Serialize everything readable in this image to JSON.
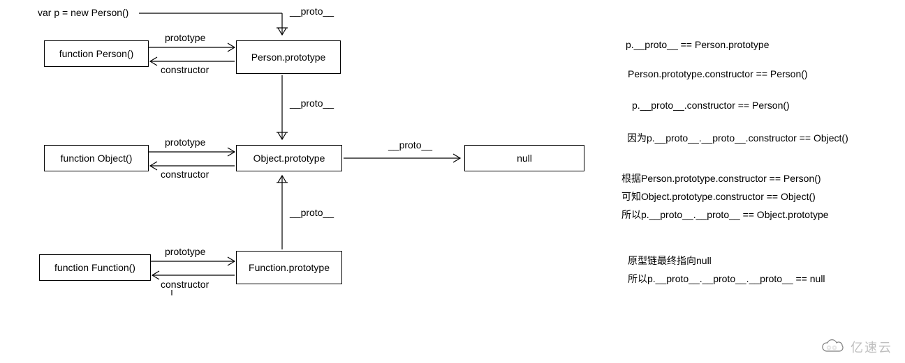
{
  "topText": "var p = new Person()",
  "boxes": {
    "personFn": "function Person()",
    "personProto": "Person.prototype",
    "objectFn": "function Object()",
    "objectProto": "Object.prototype",
    "functionFn": "function Function()",
    "functionProto": "Function.prototype",
    "null": "null"
  },
  "labels": {
    "proto": "__proto__",
    "prototype": "prototype",
    "constructor": "constructor"
  },
  "notes": {
    "n1": "p.__proto__ == Person.prototype",
    "n2": "Person.prototype.constructor ==  Person()",
    "n3": "p.__proto__.constructor ==  Person()",
    "n4": "因为p.__proto__.__proto__.constructor == Object()",
    "n5": "根据Person.prototype.constructor == Person()",
    "n6": "可知Object.prototype.constructor == Object()",
    "n7": "所以p.__proto__.__proto__ == Object.prototype",
    "n8": "原型链最终指向null",
    "n9": "所以p.__proto__.__proto__.__proto__ == null"
  },
  "watermark": "亿速云"
}
